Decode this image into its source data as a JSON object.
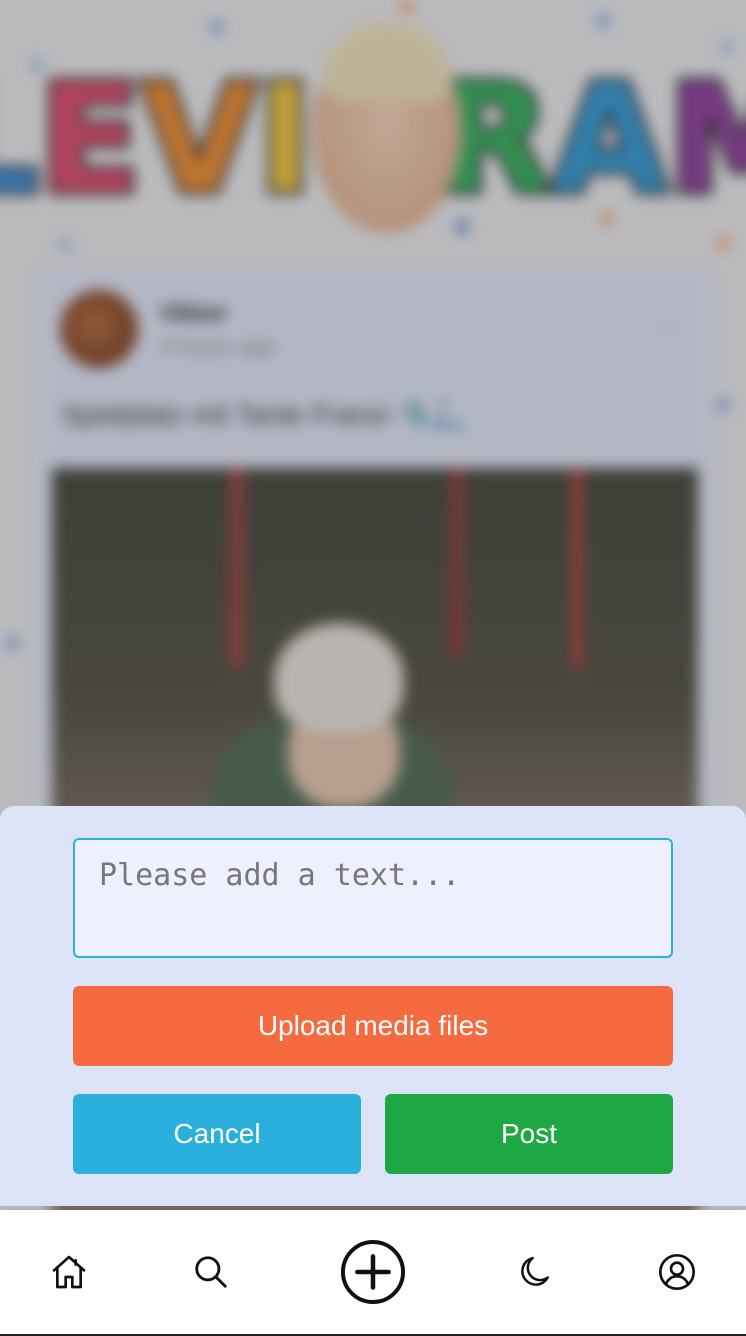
{
  "app": {
    "name": "Levigram"
  },
  "background": {
    "logo_letters": [
      {
        "ch": "L",
        "color": "#3a8ed8"
      },
      {
        "ch": "E",
        "color": "#e0466a"
      },
      {
        "ch": "V",
        "color": "#ef8a2a"
      },
      {
        "ch": "I",
        "color": "#f2c63a"
      },
      {
        "ch": "G",
        "color": "#f2c63a"
      },
      {
        "ch": "R",
        "color": "#2eb15a"
      },
      {
        "ch": "A",
        "color": "#2d9ad6"
      },
      {
        "ch": "M",
        "color": "#8e3a9c"
      }
    ],
    "post": {
      "author": "Viktor",
      "time": "4 hours ago",
      "caption": "Spielplatz mit Tante Franzi 🛝🛴",
      "menu": "···"
    }
  },
  "composer": {
    "text_placeholder": "Please add a text...",
    "text_value": "",
    "upload_label": "Upload media files",
    "cancel_label": "Cancel",
    "post_label": "Post"
  },
  "nav": {
    "items": [
      {
        "name": "home",
        "icon": "home-icon"
      },
      {
        "name": "search",
        "icon": "search-icon"
      },
      {
        "name": "create",
        "icon": "plus-circle-icon"
      },
      {
        "name": "theme",
        "icon": "moon-icon"
      },
      {
        "name": "profile",
        "icon": "user-circle-icon"
      }
    ]
  },
  "colors": {
    "accent_upload": "#f56b3f",
    "accent_cancel": "#2bb0de",
    "accent_post": "#1ea843",
    "input_border": "#2ab0dd",
    "sheet_bg": "#dde4f8"
  }
}
